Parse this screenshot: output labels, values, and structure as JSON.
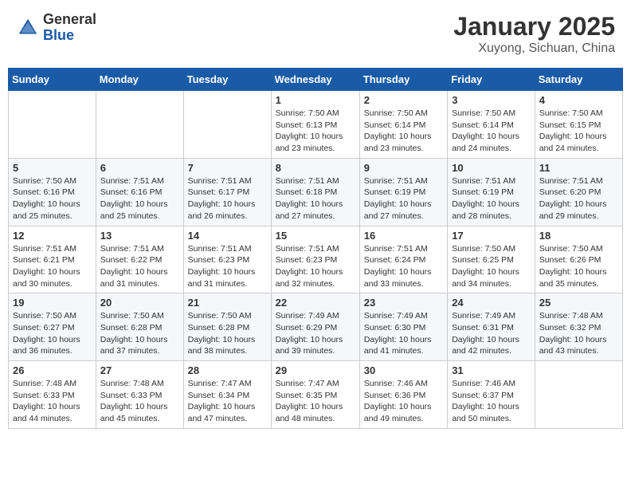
{
  "header": {
    "logo_general": "General",
    "logo_blue": "Blue",
    "month_title": "January 2025",
    "location": "Xuyong, Sichuan, China"
  },
  "days_of_week": [
    "Sunday",
    "Monday",
    "Tuesday",
    "Wednesday",
    "Thursday",
    "Friday",
    "Saturday"
  ],
  "weeks": [
    [
      {
        "day": "",
        "info": ""
      },
      {
        "day": "",
        "info": ""
      },
      {
        "day": "",
        "info": ""
      },
      {
        "day": "1",
        "info": "Sunrise: 7:50 AM\nSunset: 6:13 PM\nDaylight: 10 hours\nand 23 minutes."
      },
      {
        "day": "2",
        "info": "Sunrise: 7:50 AM\nSunset: 6:14 PM\nDaylight: 10 hours\nand 23 minutes."
      },
      {
        "day": "3",
        "info": "Sunrise: 7:50 AM\nSunset: 6:14 PM\nDaylight: 10 hours\nand 24 minutes."
      },
      {
        "day": "4",
        "info": "Sunrise: 7:50 AM\nSunset: 6:15 PM\nDaylight: 10 hours\nand 24 minutes."
      }
    ],
    [
      {
        "day": "5",
        "info": "Sunrise: 7:50 AM\nSunset: 6:16 PM\nDaylight: 10 hours\nand 25 minutes."
      },
      {
        "day": "6",
        "info": "Sunrise: 7:51 AM\nSunset: 6:16 PM\nDaylight: 10 hours\nand 25 minutes."
      },
      {
        "day": "7",
        "info": "Sunrise: 7:51 AM\nSunset: 6:17 PM\nDaylight: 10 hours\nand 26 minutes."
      },
      {
        "day": "8",
        "info": "Sunrise: 7:51 AM\nSunset: 6:18 PM\nDaylight: 10 hours\nand 27 minutes."
      },
      {
        "day": "9",
        "info": "Sunrise: 7:51 AM\nSunset: 6:19 PM\nDaylight: 10 hours\nand 27 minutes."
      },
      {
        "day": "10",
        "info": "Sunrise: 7:51 AM\nSunset: 6:19 PM\nDaylight: 10 hours\nand 28 minutes."
      },
      {
        "day": "11",
        "info": "Sunrise: 7:51 AM\nSunset: 6:20 PM\nDaylight: 10 hours\nand 29 minutes."
      }
    ],
    [
      {
        "day": "12",
        "info": "Sunrise: 7:51 AM\nSunset: 6:21 PM\nDaylight: 10 hours\nand 30 minutes."
      },
      {
        "day": "13",
        "info": "Sunrise: 7:51 AM\nSunset: 6:22 PM\nDaylight: 10 hours\nand 31 minutes."
      },
      {
        "day": "14",
        "info": "Sunrise: 7:51 AM\nSunset: 6:23 PM\nDaylight: 10 hours\nand 31 minutes."
      },
      {
        "day": "15",
        "info": "Sunrise: 7:51 AM\nSunset: 6:23 PM\nDaylight: 10 hours\nand 32 minutes."
      },
      {
        "day": "16",
        "info": "Sunrise: 7:51 AM\nSunset: 6:24 PM\nDaylight: 10 hours\nand 33 minutes."
      },
      {
        "day": "17",
        "info": "Sunrise: 7:50 AM\nSunset: 6:25 PM\nDaylight: 10 hours\nand 34 minutes."
      },
      {
        "day": "18",
        "info": "Sunrise: 7:50 AM\nSunset: 6:26 PM\nDaylight: 10 hours\nand 35 minutes."
      }
    ],
    [
      {
        "day": "19",
        "info": "Sunrise: 7:50 AM\nSunset: 6:27 PM\nDaylight: 10 hours\nand 36 minutes."
      },
      {
        "day": "20",
        "info": "Sunrise: 7:50 AM\nSunset: 6:28 PM\nDaylight: 10 hours\nand 37 minutes."
      },
      {
        "day": "21",
        "info": "Sunrise: 7:50 AM\nSunset: 6:28 PM\nDaylight: 10 hours\nand 38 minutes."
      },
      {
        "day": "22",
        "info": "Sunrise: 7:49 AM\nSunset: 6:29 PM\nDaylight: 10 hours\nand 39 minutes."
      },
      {
        "day": "23",
        "info": "Sunrise: 7:49 AM\nSunset: 6:30 PM\nDaylight: 10 hours\nand 41 minutes."
      },
      {
        "day": "24",
        "info": "Sunrise: 7:49 AM\nSunset: 6:31 PM\nDaylight: 10 hours\nand 42 minutes."
      },
      {
        "day": "25",
        "info": "Sunrise: 7:48 AM\nSunset: 6:32 PM\nDaylight: 10 hours\nand 43 minutes."
      }
    ],
    [
      {
        "day": "26",
        "info": "Sunrise: 7:48 AM\nSunset: 6:33 PM\nDaylight: 10 hours\nand 44 minutes."
      },
      {
        "day": "27",
        "info": "Sunrise: 7:48 AM\nSunset: 6:33 PM\nDaylight: 10 hours\nand 45 minutes."
      },
      {
        "day": "28",
        "info": "Sunrise: 7:47 AM\nSunset: 6:34 PM\nDaylight: 10 hours\nand 47 minutes."
      },
      {
        "day": "29",
        "info": "Sunrise: 7:47 AM\nSunset: 6:35 PM\nDaylight: 10 hours\nand 48 minutes."
      },
      {
        "day": "30",
        "info": "Sunrise: 7:46 AM\nSunset: 6:36 PM\nDaylight: 10 hours\nand 49 minutes."
      },
      {
        "day": "31",
        "info": "Sunrise: 7:46 AM\nSunset: 6:37 PM\nDaylight: 10 hours\nand 50 minutes."
      },
      {
        "day": "",
        "info": ""
      }
    ]
  ]
}
